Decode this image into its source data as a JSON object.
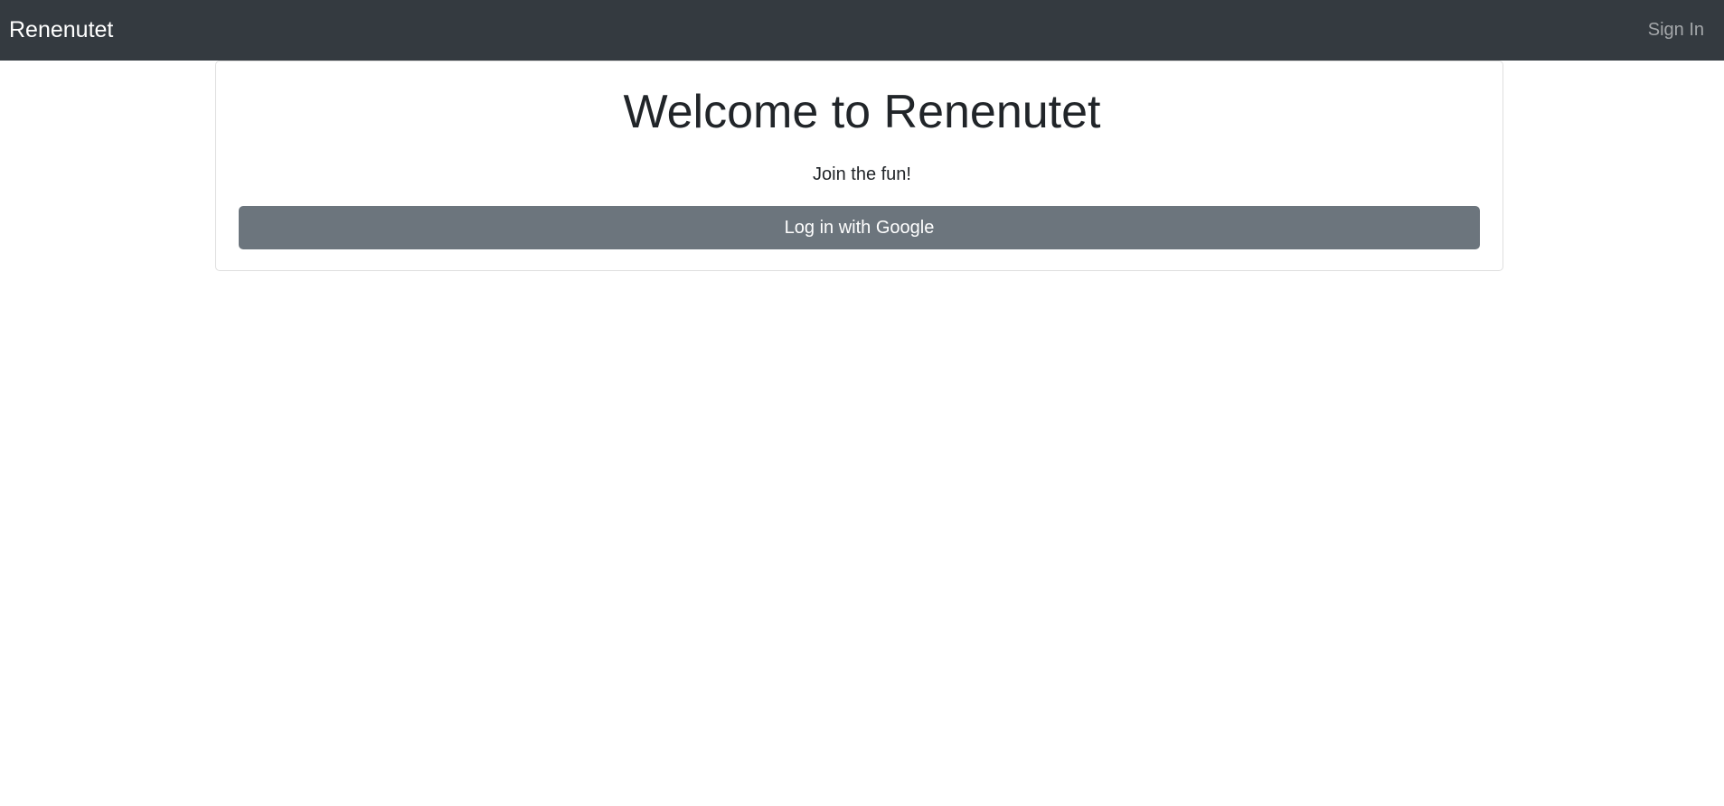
{
  "navbar": {
    "brand": "Renenutet",
    "sign_in": "Sign In",
    "background_color": "#343a40"
  },
  "card": {
    "title": "Welcome to Renenutet",
    "subtitle": "Join the fun!",
    "login_button": "Log in with Google",
    "button_color": "#6c757d"
  }
}
